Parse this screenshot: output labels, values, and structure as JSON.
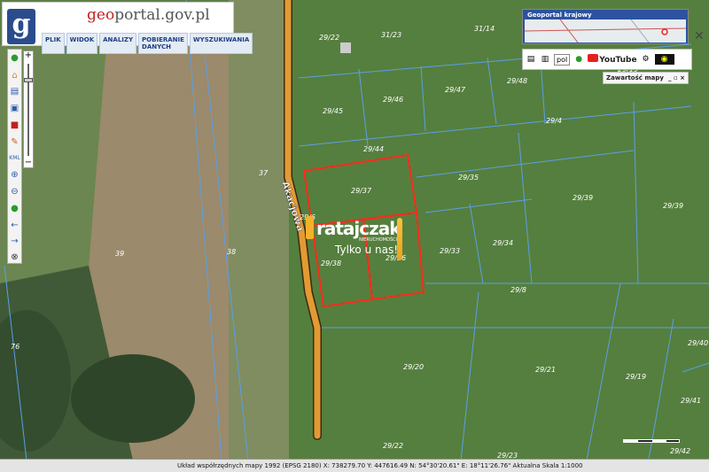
{
  "app": {
    "logo_letter": "g",
    "title_geo": "geo",
    "title_rest": "portal.gov.pl",
    "menu": [
      "PLIK",
      "WIDOK",
      "ANALIZY",
      "POBIERANIE DANYCH",
      "WYSZUKIWANIA"
    ]
  },
  "overview": {
    "title": "Geoportal krajowy"
  },
  "toolbar2": {
    "language": "pol",
    "youtube": "YouTube"
  },
  "panel": {
    "title": "Zawartość mapy",
    "controls": "_ ▫ ×"
  },
  "map": {
    "street_name": "Akacjowa",
    "parcels": [
      "29/22",
      "31/23",
      "31/14",
      "29/48",
      "29/47",
      "29/46",
      "29/45",
      "29/4",
      "29/44",
      "29/37",
      "29/35",
      "29/38",
      "29/39",
      "29/36",
      "29/33",
      "29/34",
      "29/8",
      "29/40",
      "29/20",
      "29/21",
      "29/41",
      "29/42",
      "29/23",
      "29/19",
      "29/4",
      "37",
      "38",
      "39",
      "76"
    ],
    "watermark_brand": "ratajczak",
    "watermark_sub": "NIERUCHOMOŚCI",
    "watermark_tagline": "Tylko u nas!"
  },
  "status": {
    "text": "Układ współrzędnych mapy 1992 (EPSG 2180)   X: 738279.70  Y: 447616.49   N: 54°30'20.61\"  E: 18°11'26.76\"   Aktualna Skala 1:1000"
  },
  "colors": {
    "road": "#e39a33",
    "plot_outline": "#ff2a1a",
    "boundary": "#4f8fd6"
  }
}
